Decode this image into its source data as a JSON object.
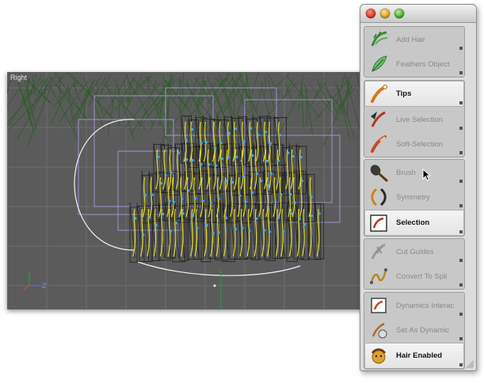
{
  "viewport": {
    "label": "Right",
    "axis_label": "Z"
  },
  "palette": {
    "groups": [
      [
        {
          "label": "Add Hair",
          "icon": "add-hair-icon",
          "active": false
        },
        {
          "label": "Feathers Object",
          "icon": "feather-icon",
          "active": false
        }
      ],
      [
        {
          "label": "Tips",
          "icon": "tips-icon",
          "active": true
        },
        {
          "label": "Live Selection",
          "icon": "live-selection-icon",
          "active": false
        },
        {
          "label": "Soft-Selection",
          "icon": "soft-selection-icon",
          "active": false
        }
      ],
      [
        {
          "label": "Brush",
          "icon": "brush-icon",
          "active": false
        },
        {
          "label": "Symmetry",
          "icon": "symmetry-icon",
          "active": false
        },
        {
          "label": "Selection",
          "icon": "selection-icon",
          "active": true
        }
      ],
      [
        {
          "label": "Cut Guides",
          "icon": "cut-guides-icon",
          "active": false
        },
        {
          "label": "Convert To Spli",
          "icon": "convert-to-spline-icon",
          "active": false
        }
      ],
      [
        {
          "label": "Dynamics Interac",
          "icon": "dynamics-interaction-icon",
          "active": false
        },
        {
          "label": "Set As Dynamic",
          "icon": "set-as-dynamic-icon",
          "active": false
        },
        {
          "label": "Hair Enabled",
          "icon": "hair-enabled-icon",
          "active": true
        }
      ]
    ]
  }
}
